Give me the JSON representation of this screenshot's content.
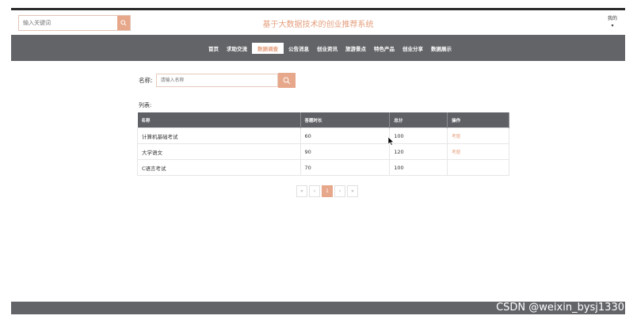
{
  "header": {
    "search_placeholder": "输入关键词",
    "site_title": "基于大数据技术的创业推荐系统",
    "user_label": "我的",
    "user_caret": "▾"
  },
  "nav": {
    "items": [
      {
        "label": "首页"
      },
      {
        "label": "求助交流"
      },
      {
        "label": "数据调查"
      },
      {
        "label": "公告消息"
      },
      {
        "label": "创业资讯"
      },
      {
        "label": "旅游景点"
      },
      {
        "label": "特色产品"
      },
      {
        "label": "创业分享"
      },
      {
        "label": "数据展示"
      }
    ],
    "active_index": 2
  },
  "filter": {
    "label": "名称:",
    "placeholder": "请输入名称"
  },
  "list": {
    "label": "列表:",
    "columns": [
      "名称",
      "答题时长",
      "总分",
      "操作"
    ],
    "rows": [
      {
        "name": "计算机基础考试",
        "duration": "60",
        "score": "100",
        "action": "考题"
      },
      {
        "name": "大学语文",
        "duration": "90",
        "score": "120",
        "action": "考题"
      },
      {
        "name": "C语言考试",
        "duration": "70",
        "score": "100",
        "action": ""
      }
    ]
  },
  "pager": {
    "first": "«",
    "prev": "‹",
    "current": "1",
    "next": "›",
    "last": "»"
  },
  "watermark": "CSDN @weixin_bysj1330",
  "colors": {
    "accent": "#e6a78a",
    "nav_bg": "#636468",
    "title": "#e59f7e"
  }
}
